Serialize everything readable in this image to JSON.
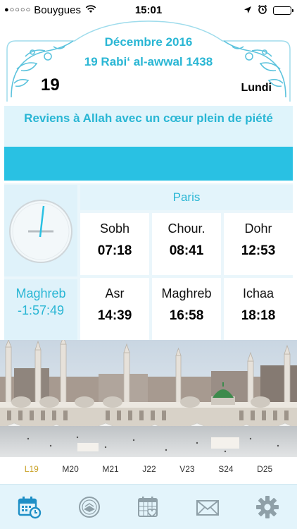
{
  "status_bar": {
    "signal_dots": "●○○○○",
    "carrier": "Bouygues",
    "time": "15:01",
    "battery_level": 1.0
  },
  "header": {
    "gregorian": "Décembre 2016",
    "hijri": "19 Rabiʻ al-awwal 1438",
    "day_number": "19",
    "day_name": "Lundi"
  },
  "verse": "Reviens à Allah avec un cœur plein de piété",
  "prayer": {
    "next_name": "Maghreb",
    "next_countdown": "-1:57:49",
    "city": "Paris",
    "times": [
      {
        "name": "Sobh",
        "time": "07:18"
      },
      {
        "name": "Chour.",
        "time": "08:41"
      },
      {
        "name": "Dohr",
        "time": "12:53"
      },
      {
        "name": "Asr",
        "time": "14:39"
      },
      {
        "name": "Maghreb",
        "time": "16:58"
      },
      {
        "name": "Ichaa",
        "time": "18:18"
      }
    ]
  },
  "days": [
    "L19",
    "M20",
    "M21",
    "J22",
    "V23",
    "S24",
    "D25"
  ],
  "tabs": [
    {
      "icon": "calendar-clock-icon"
    },
    {
      "icon": "quran-icon"
    },
    {
      "icon": "calendar-heart-icon"
    },
    {
      "icon": "mail-icon"
    },
    {
      "icon": "gear-icon"
    }
  ],
  "colors": {
    "accent": "#29b6d4",
    "bar": "#29c1e3",
    "active_day": "#c9a227",
    "tab_icon": "#1e8fc6"
  }
}
